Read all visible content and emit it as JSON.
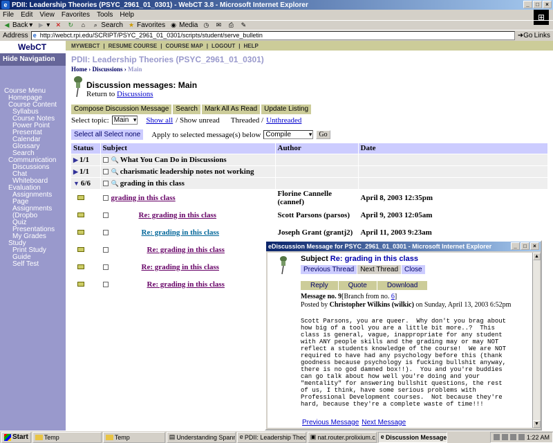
{
  "window": {
    "title": "PDII: Leadership Theories (PSYC_2961_01_0301) - WebCT 3.8 - Microsoft Internet Explorer"
  },
  "menubar": [
    "File",
    "Edit",
    "View",
    "Favorites",
    "Tools",
    "Help"
  ],
  "toolbar": {
    "back": "Back",
    "search": "Search",
    "favorites": "Favorites",
    "media": "Media"
  },
  "address": {
    "label": "Address",
    "url": "http://webct.rpi.edu/SCRIPT/PSYC_2961_01_0301/scripts/student/serve_bulletin",
    "go": "Go",
    "links": "Links"
  },
  "sidebar": {
    "logo": "WebCT",
    "hide_nav": "Hide Navigation",
    "menu_title": "Course Menu",
    "items": [
      {
        "label": "Homepage",
        "level": 1
      },
      {
        "label": "Course Content",
        "level": 1
      },
      {
        "label": "Syllabus",
        "level": 2
      },
      {
        "label": "Course Notes",
        "level": 2
      },
      {
        "label": "Power Point Presentat",
        "level": 2
      },
      {
        "label": "Calendar",
        "level": 2
      },
      {
        "label": "Glossary",
        "level": 2
      },
      {
        "label": "Search",
        "level": 2
      },
      {
        "label": "Communication",
        "level": 1
      },
      {
        "label": "Discussions",
        "level": 2
      },
      {
        "label": "Chat",
        "level": 2
      },
      {
        "label": "Whiteboard",
        "level": 2
      },
      {
        "label": "Evaluation",
        "level": 1
      },
      {
        "label": "Assignments Page",
        "level": 2
      },
      {
        "label": "Assignments (Dropbo",
        "level": 2
      },
      {
        "label": "Quiz",
        "level": 2
      },
      {
        "label": "Presentations",
        "level": 2
      },
      {
        "label": "My Grades",
        "level": 2
      },
      {
        "label": "Study",
        "level": 1
      },
      {
        "label": "Print Study Guide",
        "level": 2
      },
      {
        "label": "Self Test",
        "level": 2
      }
    ]
  },
  "topnav": [
    "MYWEBCT",
    "|",
    "RESUME COURSE",
    "|",
    "COURSE MAP",
    "|",
    "LOGOUT",
    "|",
    "HELP"
  ],
  "course_title": "PDII: Leadership Theories (PSYC_2961_01_0301)",
  "breadcrumb": {
    "home": "Home",
    "sep1": "›",
    "discussions": "Discussions",
    "sep2": "›",
    "current": "Main"
  },
  "page": {
    "heading": "Discussion messages: Main",
    "return_prefix": "Return to",
    "return_link": "Discussions"
  },
  "actions": [
    "Compose Discussion Message",
    "Search",
    "Mark All As Read",
    "Update Listing"
  ],
  "topic": {
    "label": "Select topic:",
    "value": "Main",
    "show_all": "Show all",
    "slash1": "/ Show unread",
    "threaded": "Threaded /",
    "unthreaded": "Unthreaded"
  },
  "selectrow": {
    "select_all": "Select all",
    "select_none": "Select none",
    "apply_label": "Apply to selected message(s) below",
    "apply_value": "Compile",
    "go": "Go"
  },
  "table": {
    "headers": [
      "Status",
      "Subject",
      "Author",
      "Date"
    ],
    "threads": [
      {
        "status": "1/1",
        "subject": "What You Can Do in Discussions"
      },
      {
        "status": "1/1",
        "subject": "charismatic leadership notes not working"
      },
      {
        "status": "6/6",
        "subject": "grading in this class"
      }
    ],
    "messages": [
      {
        "subject": "grading in this class",
        "author": "Florine Cannelle (cannef)",
        "date": "April 8, 2003 12:35pm"
      },
      {
        "subject": "Re: grading in this class",
        "author": "Scott Parsons (parsos)",
        "date": "April 9, 2003 12:05am"
      },
      {
        "subject": "Re: grading in this class",
        "author": "Joseph Grant (grantj2)",
        "date": "April 11, 2003 9:23am"
      },
      {
        "subject": "Re: grading in this class",
        "author": "",
        "date": ""
      },
      {
        "subject": "Re: grading in this class",
        "author": "",
        "date": ""
      },
      {
        "subject": "Re: grading in this class",
        "author": "",
        "date": ""
      }
    ]
  },
  "popup": {
    "title": "Discussion Message for PSYC_2961_01_0301 - Microsoft Internet Explorer",
    "subject_label": "Subject",
    "subject_value": "Re: grading in this class",
    "nav": [
      "Previous Thread",
      "Next Thread",
      "Close"
    ],
    "actions": [
      "Reply",
      "Quote",
      "Download"
    ],
    "message_no": "Message no. 9",
    "branch_prefix": "[Branch from no.",
    "branch_no": "6",
    "branch_suffix": "]",
    "posted_prefix": "Posted by",
    "posted_by": "Christopher Wilkins (wilkic)",
    "posted_suffix": "on Sunday, April 13, 2003 6:52pm",
    "body": "Scott Parsons, you are queer.  Why don't you brag about\nhow big of a tool you are a little bit more..?  This\nclass is general, vague, inappropriate for any student\nwith ANY people skills and the grading may or may NOT\nreflect a students knowledge of the course!  We are NOT\nrequired to have had any psychology before this (thank\ngoodness because psychology is fucking bullshit anyway,\nthere is no god damned box!!).  You and you're buddies\ncan go talk about how well you're doing and your\n\"mentality\" for answering bullshit questions, the rest\nof us, I think, have some serious problems with\nProfessional Development courses.  Not because they're\nhard, because they're a complete waste of time!!!",
    "prev_message": "Previous Message",
    "next_message": "Next Message"
  },
  "taskbar": {
    "start": "Start",
    "tasks": [
      "Temp",
      "Temp",
      "Understanding Spanni...",
      "PDII: Leadership Theo...",
      "nat.router.prolixium.c...",
      "Discussion Message..."
    ],
    "clock": "1:22 AM"
  }
}
